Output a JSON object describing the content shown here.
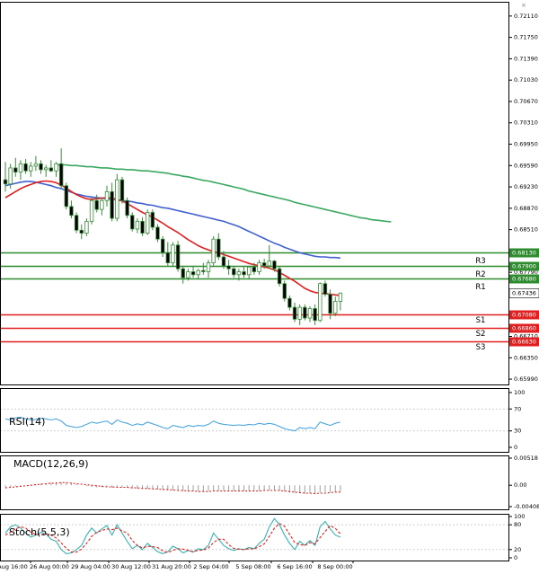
{
  "chart_data": {
    "type": "candlestick",
    "main": {
      "ylim": [
        0.659,
        0.7235
      ],
      "y_ticks": [
        "0.72110",
        "0.71750",
        "0.71390",
        "0.71030",
        "0.70670",
        "0.70310",
        "0.69950",
        "0.69590",
        "0.69230",
        "0.68870",
        "0.68510",
        "0.68150",
        "0.67790",
        "0.67430",
        "0.67070",
        "0.66710",
        "0.66350",
        "0.65990"
      ],
      "candles": [
        [
          0.6935,
          0.6965,
          0.6915,
          0.6928
        ],
        [
          0.6928,
          0.6962,
          0.692,
          0.6955
        ],
        [
          0.6955,
          0.6972,
          0.694,
          0.6948
        ],
        [
          0.6948,
          0.6968,
          0.6935,
          0.6962
        ],
        [
          0.6962,
          0.697,
          0.6945,
          0.695
        ],
        [
          0.695,
          0.6965,
          0.694,
          0.6958
        ],
        [
          0.6958,
          0.6975,
          0.695,
          0.6962
        ],
        [
          0.6962,
          0.6968,
          0.6945,
          0.6952
        ],
        [
          0.6952,
          0.696,
          0.694,
          0.6955
        ],
        [
          0.6955,
          0.6968,
          0.6948,
          0.695
        ],
        [
          0.695,
          0.6965,
          0.694,
          0.6962
        ],
        [
          0.6962,
          0.6988,
          0.692,
          0.6925
        ],
        [
          0.6925,
          0.693,
          0.6885,
          0.689
        ],
        [
          0.689,
          0.69,
          0.687,
          0.6875
        ],
        [
          0.6875,
          0.688,
          0.6845,
          0.685
        ],
        [
          0.685,
          0.686,
          0.6835,
          0.6845
        ],
        [
          0.6845,
          0.687,
          0.684,
          0.6865
        ],
        [
          0.6865,
          0.6905,
          0.686,
          0.69
        ],
        [
          0.69,
          0.691,
          0.688,
          0.6885
        ],
        [
          0.6885,
          0.6905,
          0.6875,
          0.69
        ],
        [
          0.69,
          0.6925,
          0.689,
          0.6915
        ],
        [
          0.6915,
          0.693,
          0.6865,
          0.687
        ],
        [
          0.687,
          0.6945,
          0.6865,
          0.6935
        ],
        [
          0.6935,
          0.694,
          0.6895,
          0.69
        ],
        [
          0.69,
          0.6905,
          0.687,
          0.6875
        ],
        [
          0.6875,
          0.688,
          0.6848,
          0.6852
        ],
        [
          0.6852,
          0.687,
          0.6845,
          0.6865
        ],
        [
          0.6865,
          0.6872,
          0.684,
          0.6845
        ],
        [
          0.6845,
          0.6885,
          0.6842,
          0.688
        ],
        [
          0.688,
          0.6885,
          0.685,
          0.6855
        ],
        [
          0.6855,
          0.686,
          0.683,
          0.6835
        ],
        [
          0.6835,
          0.684,
          0.6805,
          0.6812
        ],
        [
          0.6812,
          0.683,
          0.679,
          0.6795
        ],
        [
          0.6795,
          0.683,
          0.679,
          0.6825
        ],
        [
          0.6825,
          0.6832,
          0.678,
          0.6785
        ],
        [
          0.6785,
          0.679,
          0.676,
          0.677
        ],
        [
          0.677,
          0.6785,
          0.6765,
          0.678
        ],
        [
          0.678,
          0.679,
          0.677,
          0.6775
        ],
        [
          0.6775,
          0.6785,
          0.6768,
          0.6782
        ],
        [
          0.6782,
          0.6795,
          0.6775,
          0.678
        ],
        [
          0.678,
          0.68,
          0.677,
          0.6795
        ],
        [
          0.6795,
          0.684,
          0.679,
          0.6835
        ],
        [
          0.6835,
          0.6845,
          0.68,
          0.6805
        ],
        [
          0.6805,
          0.6815,
          0.6785,
          0.679
        ],
        [
          0.679,
          0.68,
          0.6775,
          0.6785
        ],
        [
          0.6785,
          0.679,
          0.677,
          0.6775
        ],
        [
          0.6775,
          0.6785,
          0.6765,
          0.678
        ],
        [
          0.678,
          0.679,
          0.677,
          0.6775
        ],
        [
          0.6775,
          0.679,
          0.6768,
          0.6788
        ],
        [
          0.6788,
          0.6795,
          0.6775,
          0.678
        ],
        [
          0.678,
          0.68,
          0.6775,
          0.6795
        ],
        [
          0.6795,
          0.6802,
          0.6785,
          0.679
        ],
        [
          0.679,
          0.6825,
          0.6785,
          0.6798
        ],
        [
          0.6798,
          0.68,
          0.678,
          0.6785
        ],
        [
          0.6785,
          0.679,
          0.6755,
          0.676
        ],
        [
          0.676,
          0.6765,
          0.673,
          0.6735
        ],
        [
          0.6735,
          0.674,
          0.6715,
          0.672
        ],
        [
          0.672,
          0.6728,
          0.6695,
          0.67
        ],
        [
          0.67,
          0.6725,
          0.669,
          0.672
        ],
        [
          0.672,
          0.6725,
          0.6698,
          0.6702
        ],
        [
          0.6702,
          0.6722,
          0.6695,
          0.6718
        ],
        [
          0.6718,
          0.6725,
          0.669,
          0.6698
        ],
        [
          0.6698,
          0.6762,
          0.6695,
          0.676
        ],
        [
          0.676,
          0.6765,
          0.6738,
          0.6742
        ],
        [
          0.6742,
          0.675,
          0.67,
          0.671
        ],
        [
          0.671,
          0.6738,
          0.6705,
          0.673
        ],
        [
          0.673,
          0.6745,
          0.6715,
          0.6744
        ]
      ],
      "ma_fast": [
        0.6905,
        0.691,
        0.6915,
        0.692,
        0.6924,
        0.6927,
        0.693,
        0.6932,
        0.6933,
        0.6932,
        0.693,
        0.6926,
        0.6921,
        0.6915,
        0.691,
        0.6906,
        0.6903,
        0.6902,
        0.6903,
        0.6904,
        0.6905,
        0.6904,
        0.6902,
        0.6899,
        0.6895,
        0.689,
        0.6885,
        0.688,
        0.6876,
        0.6872,
        0.6867,
        0.6862,
        0.6856,
        0.6851,
        0.6846,
        0.684,
        0.6834,
        0.6829,
        0.6824,
        0.682,
        0.6817,
        0.6814,
        0.6812,
        0.6809,
        0.6806,
        0.6803,
        0.68,
        0.6797,
        0.6794,
        0.6792,
        0.679,
        0.6788,
        0.6786,
        0.6783,
        0.6779,
        0.6774,
        0.6769,
        0.6764,
        0.6758,
        0.6752,
        0.6748,
        0.6745,
        0.6744,
        0.6743,
        0.6742,
        0.6741,
        0.674
      ],
      "ma_mid": [
        0.6925,
        0.6927,
        0.6929,
        0.6931,
        0.6932,
        0.6932,
        0.6931,
        0.6929,
        0.6927,
        0.6925,
        0.6922,
        0.692,
        0.6917,
        0.6914,
        0.6911,
        0.6909,
        0.6907,
        0.6906,
        0.6905,
        0.6904,
        0.6903,
        0.6902,
        0.6901,
        0.69,
        0.6899,
        0.6898,
        0.6896,
        0.6895,
        0.6893,
        0.6892,
        0.689,
        0.6888,
        0.6887,
        0.6885,
        0.6883,
        0.6881,
        0.6879,
        0.6877,
        0.6875,
        0.6873,
        0.6871,
        0.6869,
        0.6867,
        0.6865,
        0.6862,
        0.6859,
        0.6856,
        0.6852,
        0.6848,
        0.6844,
        0.684,
        0.6836,
        0.6832,
        0.6828,
        0.6825,
        0.6821,
        0.6818,
        0.6815,
        0.6812,
        0.681,
        0.6808,
        0.6806,
        0.6805,
        0.6805,
        0.6804,
        0.6804,
        0.6803
      ],
      "ma_slow": [
        0.696,
        0.696,
        0.696,
        0.6959,
        0.6959,
        0.6958,
        0.6957,
        0.6957,
        0.6956,
        0.6955,
        0.6955,
        0.6954,
        0.6953,
        0.6953,
        0.6952,
        0.6952,
        0.6951,
        0.695,
        0.695,
        0.6949,
        0.6948,
        0.6947,
        0.6946,
        0.6944,
        0.6943,
        0.6941,
        0.694,
        0.6938,
        0.6936,
        0.6934,
        0.6933,
        0.6931,
        0.6929,
        0.6927,
        0.6925,
        0.6923,
        0.6921,
        0.6919,
        0.6916,
        0.6914,
        0.6912,
        0.691,
        0.6908,
        0.6906,
        0.6904,
        0.6902,
        0.69,
        0.6897,
        0.6895,
        0.6893,
        0.6891,
        0.6889,
        0.6887,
        0.6885,
        0.6883,
        0.6881,
        0.6879,
        0.6877,
        0.6875,
        0.6873,
        0.6871,
        0.687,
        0.6868,
        0.6867,
        0.6866,
        0.6865,
        0.6864
      ],
      "ma_fast_start": 0,
      "ma_mid_start": 0,
      "ma_slow_start": 10,
      "levels": [
        {
          "name": "R3",
          "value": 0.6813,
          "label": "0.68130",
          "color": "#2e8b2e"
        },
        {
          "name": "R2",
          "value": 0.679,
          "label": "0.67900",
          "color": "#2e8b2e"
        },
        {
          "name": "R1",
          "value": 0.6768,
          "label": "0.67680",
          "color": "#2e8b2e"
        },
        {
          "name": "S1",
          "value": 0.6708,
          "label": "0.67080",
          "color": "#e02020"
        },
        {
          "name": "S2",
          "value": 0.6686,
          "label": "0.66860",
          "color": "#e02020"
        },
        {
          "name": "S3",
          "value": 0.6663,
          "label": "0.66630",
          "color": "#e02020"
        }
      ],
      "current_price": "0.67436"
    },
    "rsi": {
      "title": "RSI(14)",
      "ticks": [
        "100",
        "70",
        "30",
        "0"
      ],
      "ylim": [
        0,
        100
      ],
      "values": [
        52,
        50,
        54,
        55,
        52,
        50,
        51,
        53,
        52,
        50,
        52,
        48,
        40,
        38,
        36,
        38,
        42,
        46,
        44,
        46,
        48,
        42,
        50,
        46,
        44,
        40,
        43,
        41,
        46,
        43,
        40,
        36,
        34,
        40,
        38,
        36,
        40,
        38,
        40,
        39,
        42,
        48,
        44,
        42,
        41,
        40,
        41,
        40,
        42,
        41,
        44,
        42,
        44,
        42,
        38,
        34,
        32,
        30,
        36,
        34,
        36,
        34,
        46,
        43,
        40,
        44,
        46
      ]
    },
    "macd": {
      "title": "MACD(12,26,9)",
      "ticks": [
        "0.00518",
        "0.00",
        "-0.00408"
      ],
      "ylim": [
        -0.00408,
        0.00518
      ],
      "histogram": [
        -0.0004,
        -0.0003,
        -0.0002,
        -0.0001,
        0.0,
        0.0001,
        0.0002,
        0.0003,
        0.0004,
        0.0005,
        0.0006,
        0.0006,
        0.0005,
        0.0004,
        0.0002,
        0.0,
        -0.0002,
        -0.0003,
        -0.0004,
        -0.0004,
        -0.0004,
        -0.0005,
        -0.0004,
        -0.0004,
        -0.0005,
        -0.0006,
        -0.0007,
        -0.0007,
        -0.0007,
        -0.0007,
        -0.0008,
        -0.0009,
        -0.001,
        -0.001,
        -0.0011,
        -0.0012,
        -0.0012,
        -0.0012,
        -0.0012,
        -0.0012,
        -0.0011,
        -0.001,
        -0.001,
        -0.001,
        -0.0011,
        -0.0011,
        -0.0011,
        -0.0011,
        -0.0011,
        -0.0011,
        -0.001,
        -0.001,
        -0.001,
        -0.001,
        -0.0011,
        -0.0012,
        -0.0014,
        -0.0015,
        -0.0015,
        -0.0016,
        -0.0016,
        -0.0016,
        -0.0014,
        -0.0013,
        -0.0013,
        -0.0012,
        -0.0012
      ],
      "signal": [
        -0.0005,
        -0.0004,
        -0.0003,
        -0.0002,
        -0.0001,
        0.0,
        0.0001,
        0.0002,
        0.0003,
        0.0004,
        0.0004,
        0.0005,
        0.0005,
        0.0004,
        0.0003,
        0.0002,
        0.0001,
        0.0,
        -0.0001,
        -0.0002,
        -0.0003,
        -0.0003,
        -0.0004,
        -0.0004,
        -0.0004,
        -0.0005,
        -0.0005,
        -0.0006,
        -0.0006,
        -0.0007,
        -0.0007,
        -0.0008,
        -0.0008,
        -0.0009,
        -0.001,
        -0.001,
        -0.0011,
        -0.0011,
        -0.0012,
        -0.0012,
        -0.0012,
        -0.0011,
        -0.0011,
        -0.0011,
        -0.0011,
        -0.0011,
        -0.0011,
        -0.0011,
        -0.0011,
        -0.0011,
        -0.0011,
        -0.001,
        -0.001,
        -0.001,
        -0.001,
        -0.0011,
        -0.0012,
        -0.0013,
        -0.0014,
        -0.0015,
        -0.0015,
        -0.0016,
        -0.0015,
        -0.0015,
        -0.0014,
        -0.0013,
        -0.0013
      ]
    },
    "stoch": {
      "title": "Stoch(5,5,3)",
      "ticks": [
        "100",
        "80",
        "20",
        "0"
      ],
      "ylim": [
        0,
        100
      ],
      "main": [
        60,
        75,
        80,
        72,
        60,
        50,
        55,
        62,
        58,
        45,
        40,
        20,
        10,
        12,
        20,
        30,
        55,
        72,
        60,
        70,
        78,
        55,
        80,
        60,
        40,
        22,
        30,
        20,
        35,
        25,
        15,
        10,
        15,
        28,
        22,
        12,
        18,
        14,
        22,
        20,
        30,
        60,
        45,
        30,
        22,
        18,
        22,
        20,
        25,
        22,
        35,
        45,
        75,
        95,
        80,
        55,
        35,
        20,
        40,
        30,
        42,
        30,
        75,
        88,
        70,
        55,
        50
      ],
      "signal": [
        55,
        62,
        70,
        75,
        72,
        62,
        56,
        56,
        58,
        55,
        48,
        36,
        23,
        14,
        14,
        21,
        35,
        52,
        62,
        66,
        70,
        68,
        72,
        65,
        60,
        42,
        30,
        24,
        28,
        27,
        25,
        17,
        13,
        18,
        22,
        21,
        18,
        15,
        18,
        19,
        24,
        37,
        45,
        45,
        32,
        23,
        21,
        20,
        22,
        22,
        27,
        34,
        52,
        72,
        83,
        76,
        57,
        37,
        32,
        30,
        37,
        34,
        49,
        64,
        78,
        71,
        58
      ]
    },
    "x_ticks": [
      "Aug 16:00",
      "26 Aug 00:00",
      "29 Aug 04:00",
      "30 Aug 12:00",
      "31 Aug 20:00",
      "2 Sep 04:00",
      "5 Sep 08:00",
      "6 Sep 16:00",
      "8 Sep 00:00"
    ],
    "colors": {
      "ma_fast": "#e02020",
      "ma_mid": "#4060d0",
      "ma_slow": "#3aa860",
      "candle_up": "#3a8a3a",
      "candle_down": "#3a8a3a",
      "rsi": "#4aa6dd",
      "macd_hist": "#a0a0a0",
      "macd_signal": "#e02020",
      "stoch_main": "#3ab0b0",
      "stoch_signal": "#e02020"
    }
  }
}
